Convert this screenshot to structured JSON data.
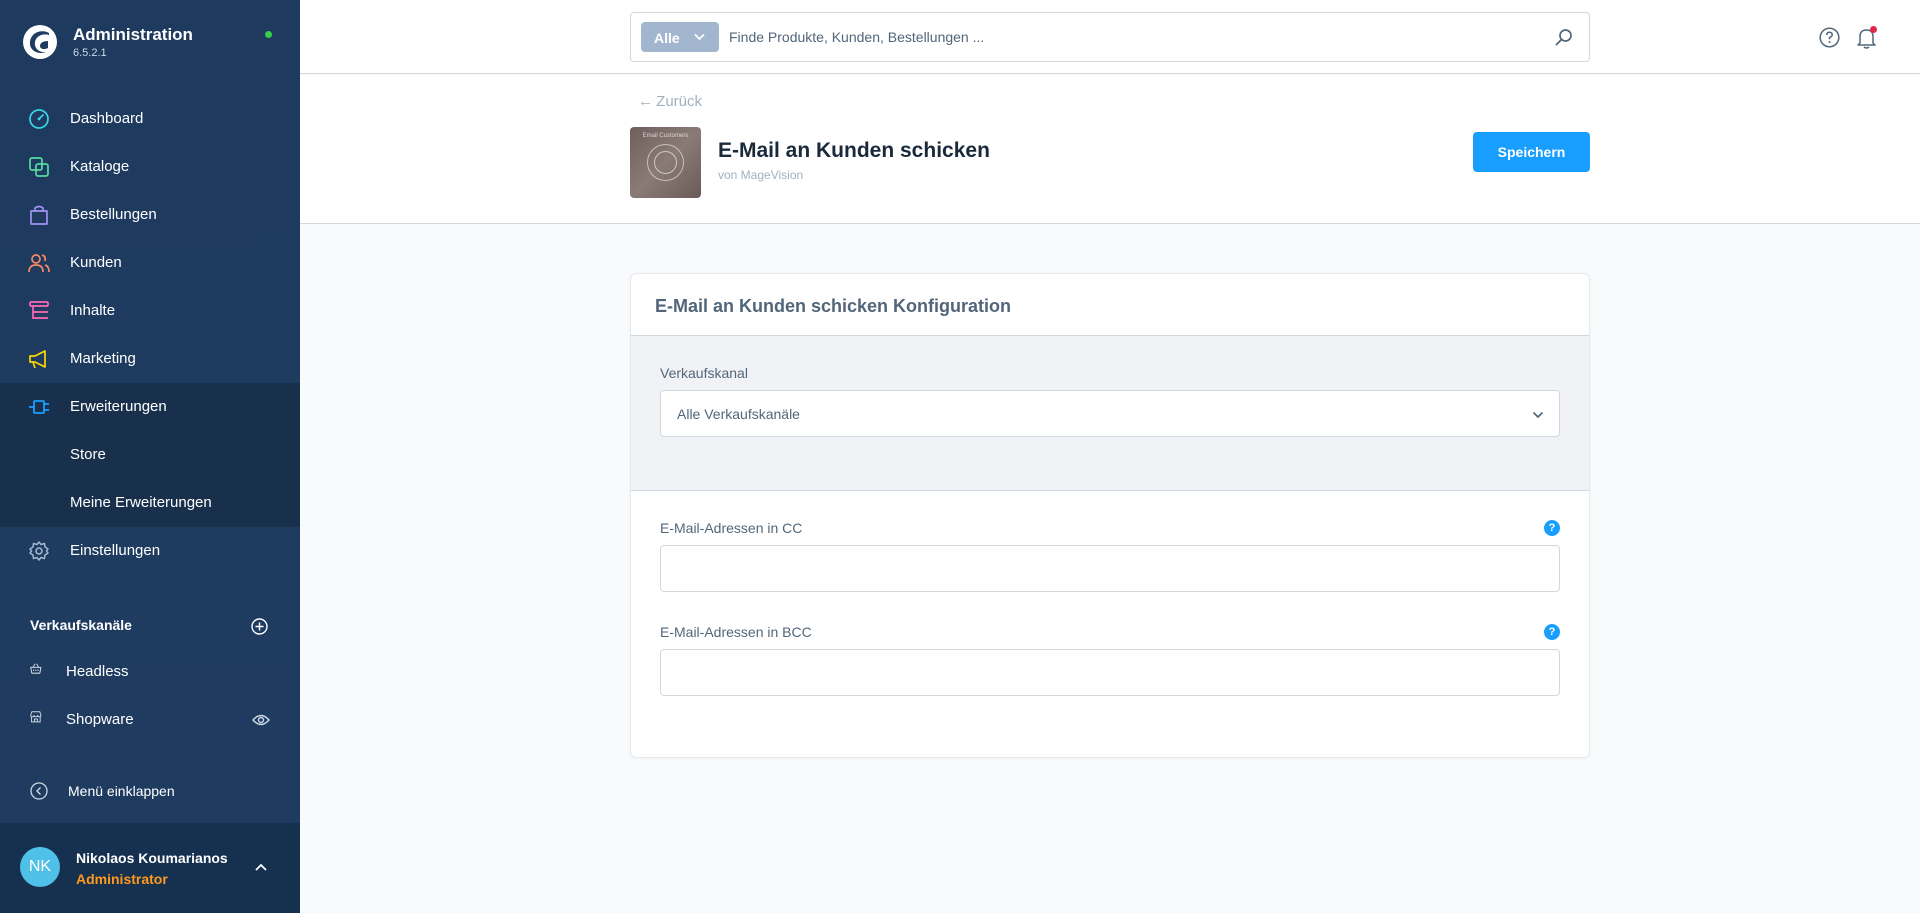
{
  "app": {
    "title": "Administration",
    "version": "6.5.2.1"
  },
  "nav": {
    "items": [
      {
        "label": "Dashboard",
        "icon": "dashboard-icon"
      },
      {
        "label": "Kataloge",
        "icon": "catalog-icon"
      },
      {
        "label": "Bestellungen",
        "icon": "orders-icon"
      },
      {
        "label": "Kunden",
        "icon": "customers-icon"
      },
      {
        "label": "Inhalte",
        "icon": "content-icon"
      },
      {
        "label": "Marketing",
        "icon": "marketing-icon"
      },
      {
        "label": "Erweiterungen",
        "icon": "extensions-icon"
      },
      {
        "label": "Einstellungen",
        "icon": "settings-icon"
      }
    ],
    "sub_items": [
      {
        "label": "Store"
      },
      {
        "label": "Meine Erweiterungen"
      }
    ],
    "sales_channels_title": "Verkaufskanäle",
    "sales_channels": [
      {
        "label": "Headless",
        "icon": "basket-icon"
      },
      {
        "label": "Shopware",
        "icon": "storefront-icon"
      }
    ],
    "collapse_label": "Menü einklappen"
  },
  "user": {
    "initials": "NK",
    "name": "Nikolaos Koumarianos",
    "role": "Administrator"
  },
  "search": {
    "type_label": "Alle",
    "placeholder": "Finde Produkte, Kunden, Bestellungen ..."
  },
  "header": {
    "back_label": "Zurück",
    "plugin_title": "E-Mail an Kunden schicken",
    "plugin_vendor": "von MageVision",
    "plugin_image_caption": "Email Customers",
    "save_label": "Speichern"
  },
  "card": {
    "title": "E-Mail an Kunden schicken Konfiguration",
    "sales_channel_label": "Verkaufskanal",
    "sales_channel_value": "Alle Verkaufskanäle",
    "cc_label": "E-Mail-Adressen in CC",
    "cc_value": "",
    "bcc_label": "E-Mail-Adressen in BCC",
    "bcc_value": "",
    "help_glyph": "?"
  },
  "colors": {
    "sidebar_bg": "#1f3c60",
    "accent": "#189eff",
    "user_role": "#ff9a1e",
    "online": "#37d046",
    "notification": "#de294c"
  }
}
